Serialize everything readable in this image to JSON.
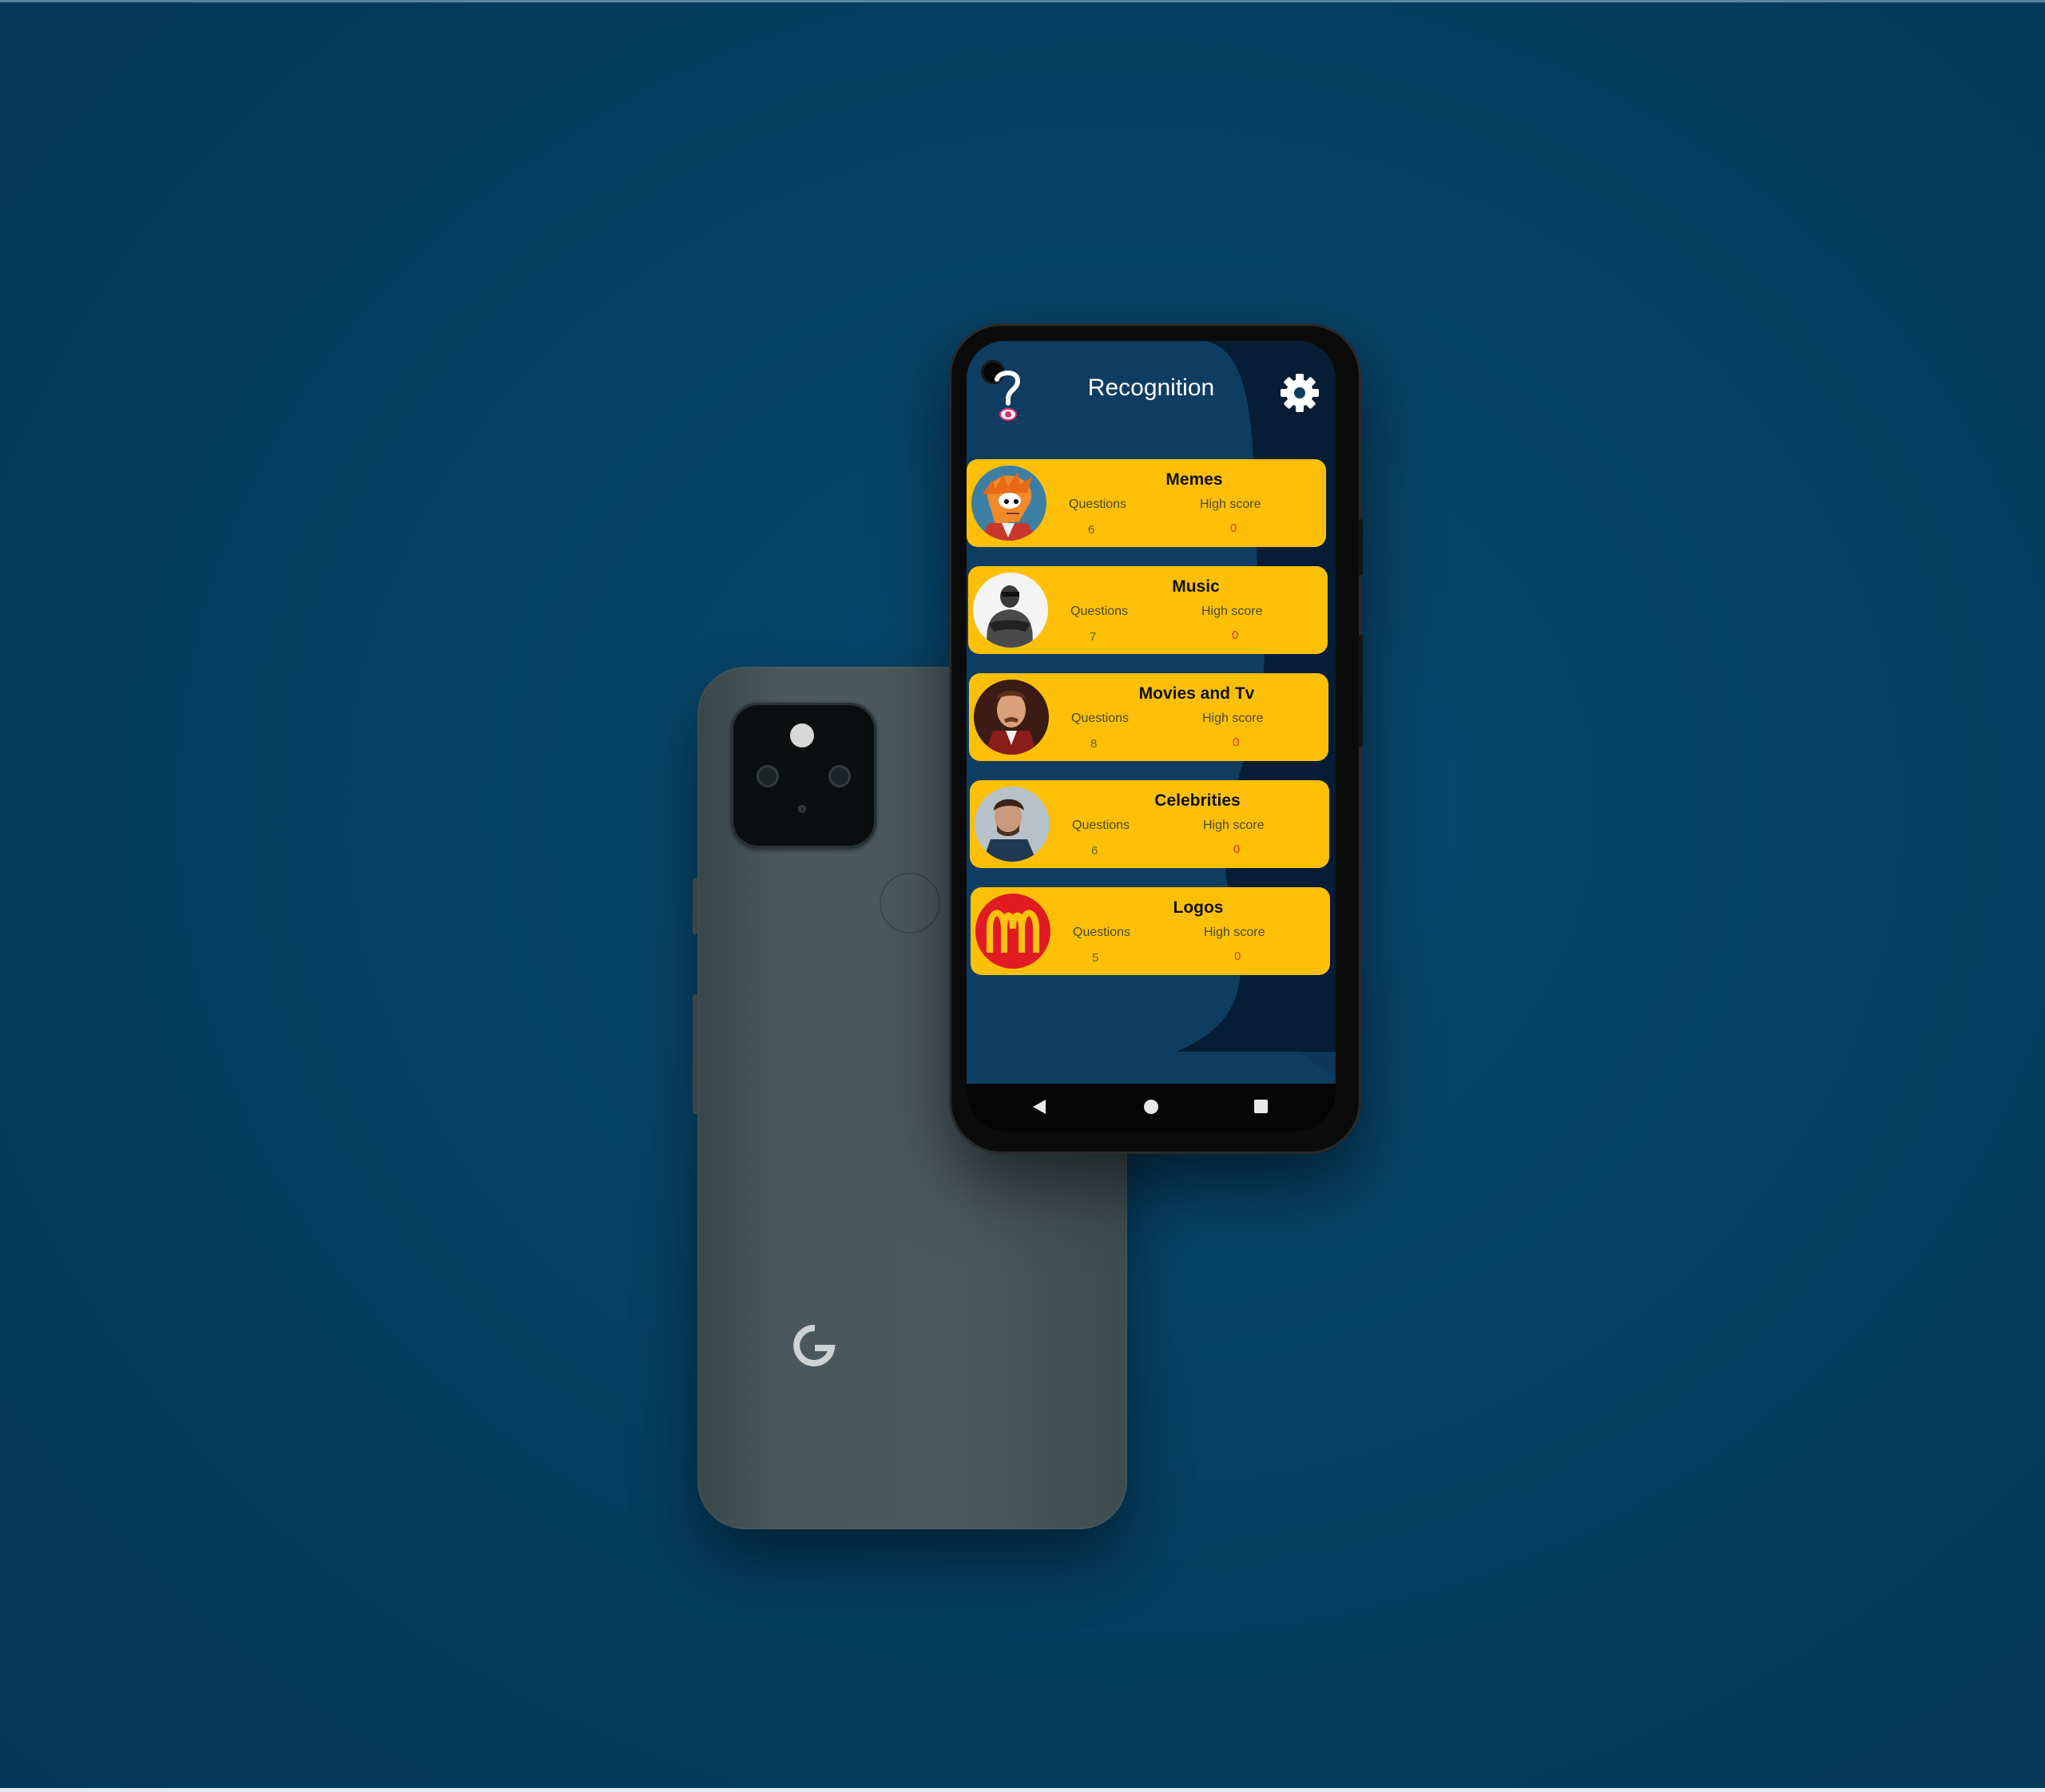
{
  "app": {
    "title": "Recognition"
  },
  "categories": [
    {
      "title": "Memes",
      "questions_label": "Questions",
      "questions": "6",
      "highscore_label": "High score",
      "highscore": "0",
      "avatar": "meme-avatar"
    },
    {
      "title": "Music",
      "questions_label": "Questions",
      "questions": "7",
      "highscore_label": "High score",
      "highscore": "0",
      "avatar": "music-avatar"
    },
    {
      "title": "Movies and Tv",
      "questions_label": "Questions",
      "questions": "8",
      "highscore_label": "High score",
      "highscore": "0",
      "avatar": "movies-avatar"
    },
    {
      "title": "Celebrities",
      "questions_label": "Questions",
      "questions": "6",
      "highscore_label": "High score",
      "highscore": "0",
      "avatar": "celebrities-avatar"
    },
    {
      "title": "Logos",
      "questions_label": "Questions",
      "questions": "5",
      "highscore_label": "High score",
      "highscore": "0",
      "avatar": "logos-avatar"
    }
  ],
  "icons": {
    "logo": "question-mark-eye-icon",
    "settings": "gear-icon",
    "nav_back": "triangle-back-icon",
    "nav_home": "circle-home-icon",
    "nav_recent": "square-recent-icon",
    "brand": "google-g-logo"
  },
  "colors": {
    "card": "#fec007",
    "screen_bg": "#0f3a5c",
    "screen_dark": "#061a33",
    "highscore": "#e8322a",
    "page_bg": "#064064"
  }
}
